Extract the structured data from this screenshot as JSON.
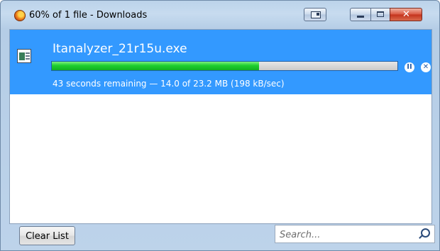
{
  "window": {
    "title": "60% of 1 file - Downloads"
  },
  "download": {
    "file_name": "Itanalyzer_21r15u.exe",
    "progress_percent": 60,
    "status": "43 seconds remaining — 14.0 of 23.2 MB (198 kB/sec)",
    "pause_icon": "pause-icon",
    "cancel_icon": "cancel-icon"
  },
  "footer": {
    "clear_list_label": "Clear List",
    "search_placeholder": "Search..."
  },
  "colors": {
    "selection": "#3399ff",
    "progress": "#1fcf2f",
    "close_button": "#c3321c"
  }
}
